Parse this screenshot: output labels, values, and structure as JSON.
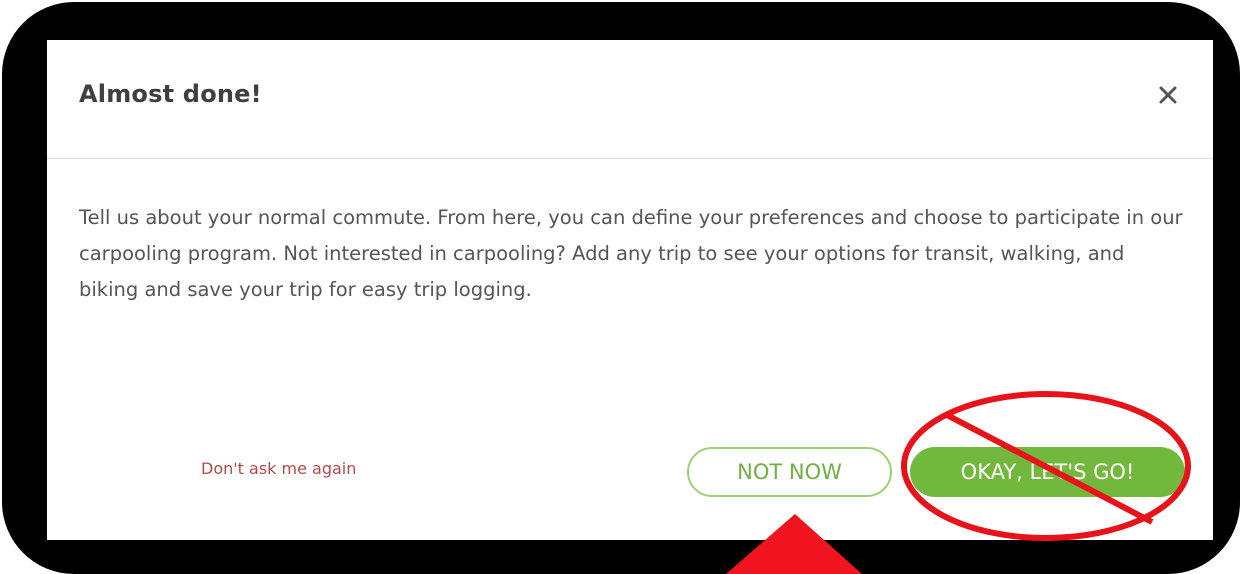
{
  "dialog": {
    "title": "Almost done!",
    "close_label": "×",
    "body_text": "Tell us about your normal commute. From here, you can define your preferences and choose to participate in our carpooling program. Not interested in carpooling? Add any trip to see your options for transit, walking, and biking and save your trip for easy trip logging.",
    "dont_ask_label": "Don't ask me again",
    "not_now_label": "NOT NOW",
    "okay_label": "OKAY, LET'S GO!"
  },
  "annotations": {
    "prohibition_color": "#e8121a",
    "arrow_color": "#f0141e"
  },
  "colors": {
    "accent_green": "#72b83d",
    "outline_green": "#9dd175",
    "link_red": "#b34a4a",
    "frame": "#000000"
  }
}
